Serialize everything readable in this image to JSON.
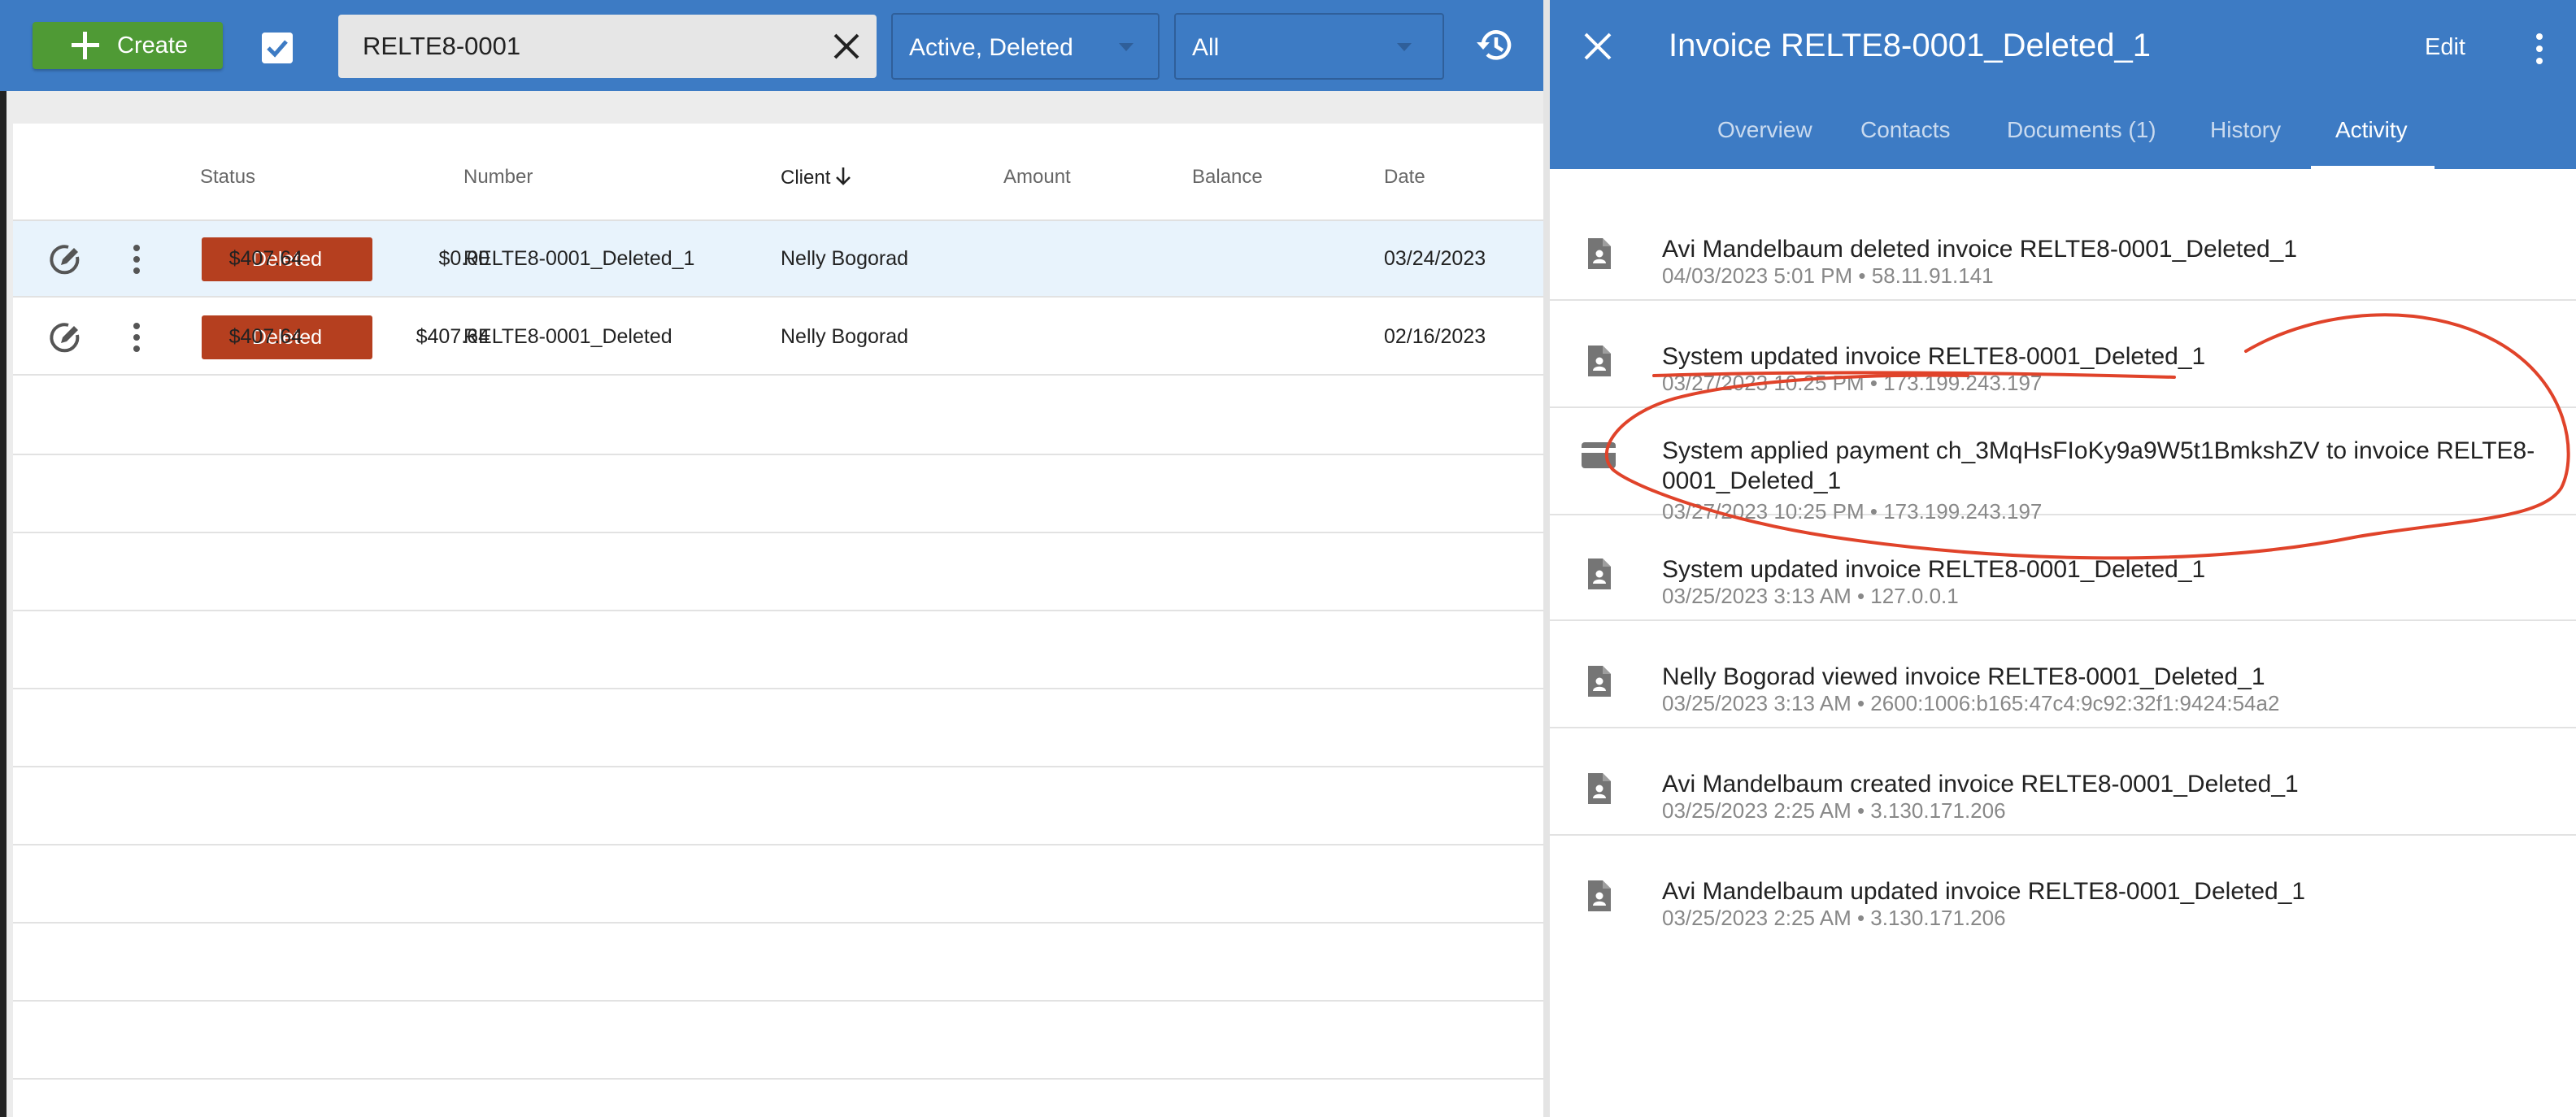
{
  "toolbar": {
    "create_label": "Create",
    "search": {
      "value": "RELTE8-0001"
    },
    "status_filter": "Active, Deleted",
    "client_filter": "All"
  },
  "table": {
    "columns": {
      "status": "Status",
      "number": "Number",
      "client": "Client",
      "amount": "Amount",
      "balance": "Balance",
      "date": "Date"
    },
    "rows": [
      {
        "status": "Deleted",
        "number": "RELTE8-0001_Deleted_1",
        "client": "Nelly Bogorad",
        "amount": "$407.64",
        "balance": "$0.00",
        "date": "03/24/2023"
      },
      {
        "status": "Deleted",
        "number": "RELTE8-0001_Deleted",
        "client": "Nelly Bogorad",
        "amount": "$407.64",
        "balance": "$407.64",
        "date": "02/16/2023"
      }
    ]
  },
  "detail": {
    "title": "Invoice RELTE8-0001_Deleted_1",
    "edit_label": "Edit",
    "tabs": [
      "Overview",
      "Contacts",
      "Documents (1)",
      "History",
      "Activity"
    ],
    "active_tab": "Activity",
    "activities": [
      {
        "icon": "document-icon",
        "text": "Avi Mandelbaum deleted invoice RELTE8-0001_Deleted_1",
        "meta": "04/03/2023 5:01 PM • 58.11.91.141"
      },
      {
        "icon": "document-icon",
        "text": "System updated invoice RELTE8-0001_Deleted_1",
        "meta": "03/27/2023 10:25 PM • 173.199.243.197"
      },
      {
        "icon": "credit-card-icon",
        "text": "System applied payment ch_3MqHsFIoKy9a9W5t1BmkshZV to invoice RELTE8-0001_Deleted_1",
        "meta": "03/27/2023 10:25 PM • 173.199.243.197"
      },
      {
        "icon": "document-icon",
        "text": "System updated invoice RELTE8-0001_Deleted_1",
        "meta": "03/25/2023 3:13 AM • 127.0.0.1"
      },
      {
        "icon": "document-icon",
        "text": "Nelly Bogorad viewed invoice RELTE8-0001_Deleted_1",
        "meta": "03/25/2023 3:13 AM • 2600:1006:b165:47c4:9c92:32f1:9424:54a2"
      },
      {
        "icon": "document-icon",
        "text": "Avi Mandelbaum created invoice RELTE8-0001_Deleted_1",
        "meta": "03/25/2023 2:25 AM • 3.130.171.206"
      },
      {
        "icon": "document-icon",
        "text": "Avi Mandelbaum updated invoice RELTE8-0001_Deleted_1",
        "meta": "03/25/2023 2:25 AM • 3.130.171.206"
      }
    ]
  },
  "colors": {
    "header_blue": "#3d7bc4",
    "create_green": "#4f9a35",
    "deleted_badge": "#b53f1f",
    "selected_row": "#e8f3fc",
    "annotation_red": "#e0432a"
  }
}
